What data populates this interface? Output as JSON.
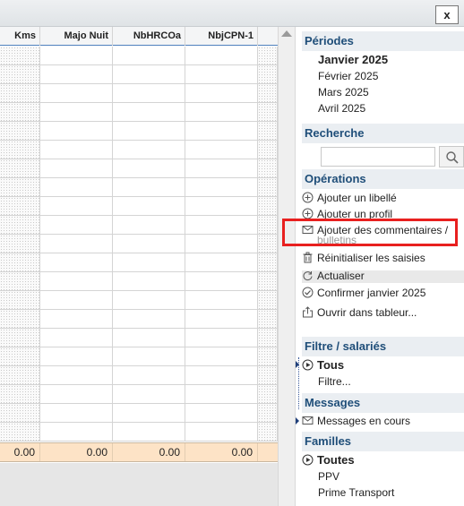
{
  "window": {
    "close_label": "x"
  },
  "grid": {
    "columns": [
      {
        "label": "Kms"
      },
      {
        "label": "Majo Nuit"
      },
      {
        "label": "NbHRCOa"
      },
      {
        "label": "NbjCPN-1"
      }
    ],
    "totals": [
      "0.00",
      "0.00",
      "0.00",
      "0.00"
    ]
  },
  "panel": {
    "periodes": {
      "title": "Périodes",
      "items": [
        "Janvier 2025",
        "Février 2025",
        "Mars 2025",
        "Avril 2025"
      ],
      "selected": "Janvier 2025"
    },
    "recherche": {
      "title": "Recherche",
      "value": ""
    },
    "operations": {
      "title": "Opérations",
      "items": [
        {
          "label": "Ajouter un libellé",
          "icon": "plus-circle-icon"
        },
        {
          "label": "Ajouter un profil",
          "icon": "plus-circle-icon"
        },
        {
          "label": "Ajouter des commentaires /",
          "icon": "envelope-icon"
        },
        {
          "label": "bulletins",
          "icon": ""
        },
        {
          "label": "Réinitialiser les saisies",
          "icon": "trash-icon"
        },
        {
          "label": "Actualiser",
          "icon": "refresh-icon"
        },
        {
          "label": "Confirmer janvier 2025",
          "icon": "check-circle-icon"
        },
        {
          "label": "Ouvrir dans tableur...",
          "icon": "export-icon"
        }
      ]
    },
    "filtre": {
      "title": "Filtre / salariés",
      "items": [
        "Tous",
        "Filtre..."
      ]
    },
    "messages": {
      "title": "Messages",
      "items": [
        "Messages en cours"
      ]
    },
    "familles": {
      "title": "Familles",
      "items": [
        "Toutes",
        "PPV",
        "Prime Transport"
      ]
    }
  },
  "colors": {
    "highlight": "#e8201f",
    "section_text": "#1f4e79",
    "totals_bg": "#fde3c6"
  }
}
